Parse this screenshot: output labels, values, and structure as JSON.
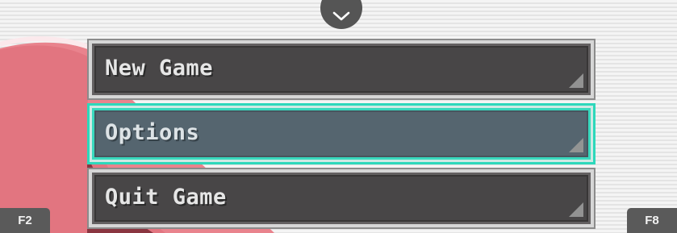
{
  "top_toggle": {
    "icon": "chevron-down-icon"
  },
  "menu": {
    "items": [
      {
        "label": "New Game",
        "selected": false
      },
      {
        "label": "Options",
        "selected": true
      },
      {
        "label": "Quit Game",
        "selected": false
      }
    ]
  },
  "function_keys": {
    "left": "F2",
    "right": "F8"
  },
  "colors": {
    "selection_accent": "#2dd8bb",
    "button_fill": "#3d3a3b",
    "selected_fill": "#4b5a66",
    "background_pink": "#e97a85"
  }
}
